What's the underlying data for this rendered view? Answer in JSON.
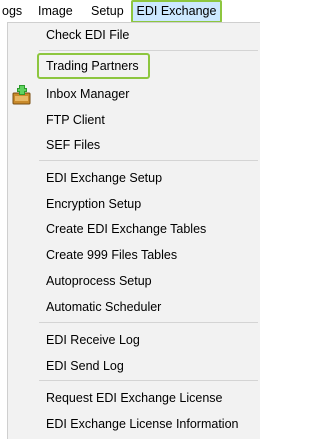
{
  "menubar": {
    "items": [
      "ogs",
      "Image",
      "Setup",
      "EDI Exchange"
    ]
  },
  "menu": {
    "items": [
      "Check EDI File",
      "Trading Partners",
      "Inbox Manager",
      "FTP Client",
      "SEF Files",
      "EDI Exchange Setup",
      "Encryption Setup",
      "Create EDI Exchange Tables",
      "Create 999 Files Tables",
      "Autoprocess Setup",
      "Automatic Scheduler",
      "EDI Receive Log",
      "EDI Send Log",
      "Request EDI Exchange License",
      "EDI Exchange License Information"
    ]
  },
  "icons": {
    "inbox_manager": "inbox-plus-icon"
  },
  "colors": {
    "highlight_border": "#8dc63f",
    "active_menu_bg": "#cce8ff",
    "menu_bg": "#f2f2f2"
  }
}
